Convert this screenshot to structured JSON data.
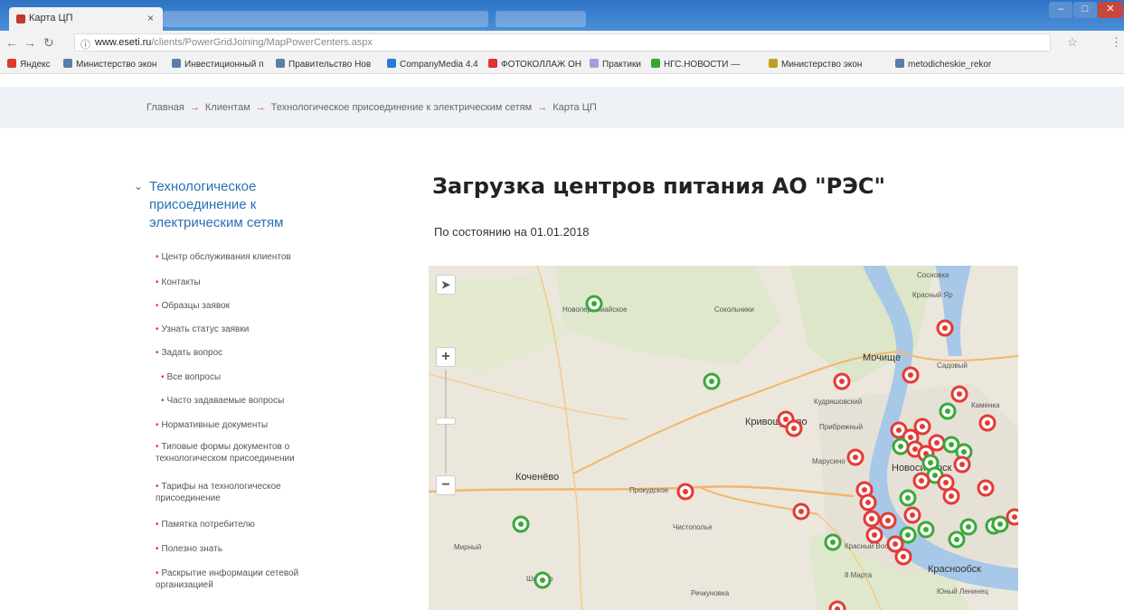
{
  "browser": {
    "tab_title": "Карта ЦП",
    "tab_close": "×",
    "url_host": "www.eseti.ru",
    "url_path": "/clients/PowerGridJoining/MapPowerCenters.aspx",
    "bookmarks": [
      {
        "label": "Яндекс",
        "color": "#e03a2f"
      },
      {
        "label": "Министерство экон",
        "color": "#5a7ea8"
      },
      {
        "label": "Инвестиционный п",
        "color": "#5a7ea8"
      },
      {
        "label": "Правительство Нов",
        "color": "#5a7ea8"
      },
      {
        "label": "CompanyMedia 4.4",
        "color": "#2b7bd6"
      },
      {
        "label": "ФОТОКОЛЛАЖ ОН",
        "color": "#d33"
      },
      {
        "label": "Практики",
        "color": "#a0a0d8"
      },
      {
        "label": "НГС.НОВОСТИ —",
        "color": "#39a535"
      },
      {
        "label": "Министерство экон",
        "color": "#c0a020"
      },
      {
        "label": "metodicheskie_rekor",
        "color": "#5a7ea8"
      }
    ]
  },
  "breadcrumbs": [
    "Главная",
    "Клиентам",
    "Технологическое присоединение к электрическим сетям",
    "Карта ЦП"
  ],
  "sidebar": {
    "heading": "Технологическое присоединение к электрическим сетям",
    "items": [
      "Центр обслуживания клиентов",
      "Контакты",
      "Образцы заявок",
      "Узнать статус заявки",
      "Задать вопрос",
      "Все вопросы",
      "Часто задаваемые вопросы",
      "Нормативные документы",
      "Типовые формы документов о технологическом присоединении",
      "Тарифы на технологическое присоединение",
      "Памятка потребителю",
      "Полезно знать",
      "Раскрытие информации сетевой организацией"
    ]
  },
  "main": {
    "title": "Загрузка центров питания АО \"РЭС\"",
    "subtitle": "По состоянию на 01.01.2018"
  },
  "map": {
    "zoom_in": "+",
    "zoom_out": "−",
    "labels": [
      "Новопервомайское",
      "Сокольники",
      "Кудряшовский",
      "Кривощёково",
      "Прибрежный",
      "Мочище",
      "Сосновка",
      "Красный Яр",
      "Садовый",
      "Каменка",
      "Марусино",
      "Новосибирск",
      "Коченёво",
      "Прокудское",
      "Чистополье",
      "Краснообск",
      "8 Марта",
      "Мирный",
      "Красный Восток",
      "Юный Ленинец",
      "Речкуновка",
      "Шилово"
    ],
    "colors": {
      "red": "#e53935",
      "green": "#3aa83a"
    }
  }
}
